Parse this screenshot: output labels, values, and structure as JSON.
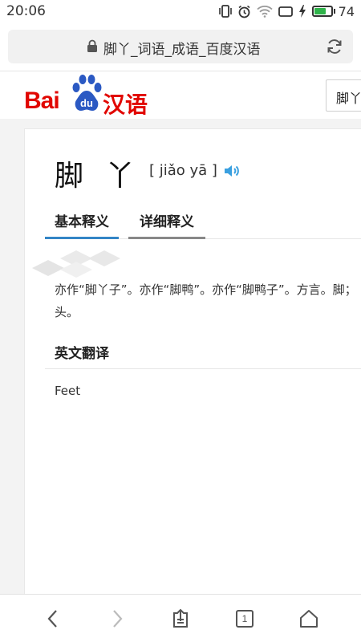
{
  "status_bar": {
    "time": "20:06",
    "battery_percent": "74",
    "battery_level": 0.74,
    "battery_color": "#2fb34a",
    "icons": [
      "vibrate-icon",
      "alarm-icon",
      "wifi-icon",
      "screen-icon",
      "charging-icon",
      "battery-icon"
    ]
  },
  "browser": {
    "address": "脚丫_词语_成语_百度汉语",
    "current_tab_count": "1"
  },
  "site": {
    "logo_latin": "Bai",
    "logo_du": "du",
    "logo_cn": "汉语",
    "brand_color": "#e10601",
    "search_value": "脚丫"
  },
  "entry": {
    "word": "脚 丫",
    "pinyin": "[ jiǎo yā ]",
    "tabs": [
      {
        "label": "基本释义",
        "active": true
      },
      {
        "label": "详细释义",
        "active": false
      }
    ],
    "definition_line1": "亦作“脚丫子”。亦作“脚鸭”。亦作“脚鸭子”。方言。脚；",
    "definition_line2": "头。",
    "english_title": "英文翻译",
    "english_value": "Feet"
  },
  "accent_color": "#3385c6"
}
